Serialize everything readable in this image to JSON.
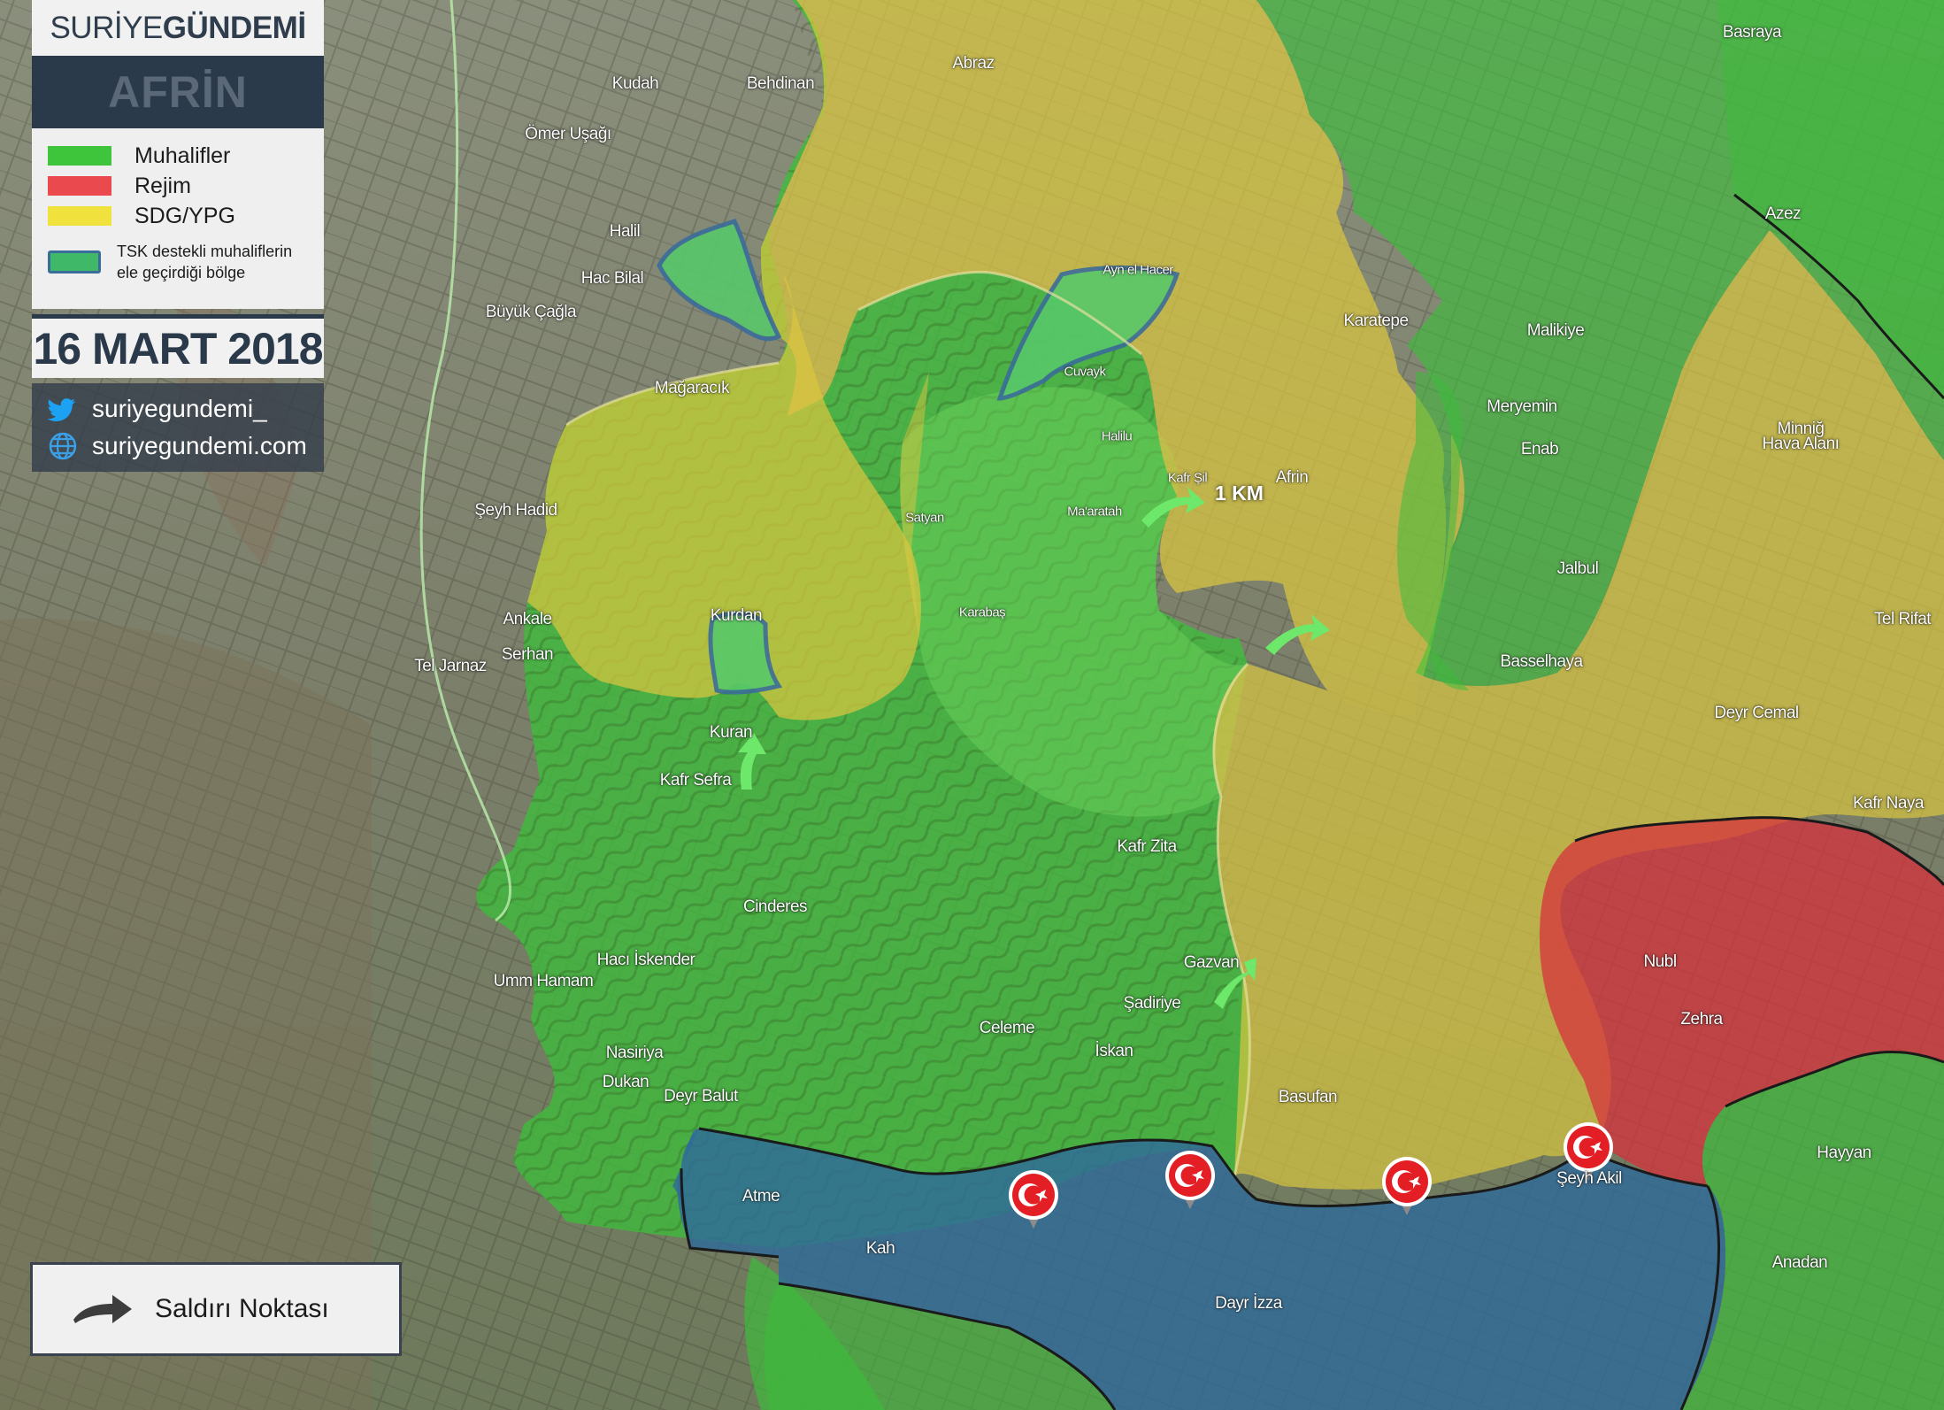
{
  "brand": {
    "prefix": "SURİYE ",
    "name": "GÜNDEMİ",
    "region": "AFRİN"
  },
  "legend": {
    "items": [
      {
        "label": "Muhalifler",
        "color": "#3fc53b"
      },
      {
        "label": "Rejim",
        "color": "#ea4a4e"
      },
      {
        "label": "SDG/YPG",
        "color": "#f0e13c"
      }
    ],
    "tsk_label": "TSK destekli muhaliflerin ele geçirdiği bölge"
  },
  "date": "16 MART 2018",
  "social": {
    "twitter": "suriyegundemi_",
    "website": "suriyegundemi.com"
  },
  "attack_legend": {
    "label": "Saldırı Noktası"
  },
  "distance_label": "1 KM",
  "colors": {
    "opposition": "#3ebb3c",
    "regime": "#d7323c",
    "sdf_ypg": "#d9c640",
    "tsk_captured": "#58c86a",
    "idlib_zone": "#2f6a9a",
    "brand_dark": "#2b3a4a",
    "arrow": "#6ee86a",
    "flag": "#e31e24"
  },
  "icons": [
    "twitter-icon",
    "globe-icon",
    "arrow-icon",
    "turkish-flag-marker-icon"
  ],
  "towns": [
    {
      "name": "Basraya"
    },
    {
      "name": "Kudah"
    },
    {
      "name": "Behdinan"
    },
    {
      "name": "Abraz"
    },
    {
      "name": "Ömer Uşağı"
    },
    {
      "name": "Halil"
    },
    {
      "name": "Hac Bilal"
    },
    {
      "name": "Büyük Çağla"
    },
    {
      "name": "Mağaracık"
    },
    {
      "name": "Ayn el Hacer"
    },
    {
      "name": "Cuvayk"
    },
    {
      "name": "Halilu"
    },
    {
      "name": "Kafr Şil"
    },
    {
      "name": "Afrin"
    },
    {
      "name": "Satyan"
    },
    {
      "name": "Ma'aratah"
    },
    {
      "name": "Karatepe"
    },
    {
      "name": "Malikiye"
    },
    {
      "name": "Azez"
    },
    {
      "name": "Meryemin"
    },
    {
      "name": "Enab"
    },
    {
      "name": "Minniğ"
    },
    {
      "name": "Hava Alanı"
    },
    {
      "name": "Şeyh Hadid"
    },
    {
      "name": "Karabaş"
    },
    {
      "name": "Kurdan"
    },
    {
      "name": "Ankale"
    },
    {
      "name": "Serhan"
    },
    {
      "name": "Tel Jarnaz"
    },
    {
      "name": "Jalbul"
    },
    {
      "name": "Tel Rifat"
    },
    {
      "name": "Basselhaya"
    },
    {
      "name": "Kuran"
    },
    {
      "name": "Kafr Sefra"
    },
    {
      "name": "Deyr Cemal"
    },
    {
      "name": "Kafr Naya"
    },
    {
      "name": "Kafr Zita"
    },
    {
      "name": "Cinderes"
    },
    {
      "name": "Hacı İskender"
    },
    {
      "name": "Umm Hamam"
    },
    {
      "name": "Gazvan"
    },
    {
      "name": "Nubl"
    },
    {
      "name": "Şadiriye"
    },
    {
      "name": "Celeme"
    },
    {
      "name": "Zehra"
    },
    {
      "name": "İskan"
    },
    {
      "name": "Nasiriya"
    },
    {
      "name": "Dukan"
    },
    {
      "name": "Deyr Balut"
    },
    {
      "name": "Basufan"
    },
    {
      "name": "Şeyh Akil"
    },
    {
      "name": "Hayyan"
    },
    {
      "name": "Atme"
    },
    {
      "name": "Kah"
    },
    {
      "name": "Anadan"
    },
    {
      "name": "Dayr İzza"
    }
  ]
}
